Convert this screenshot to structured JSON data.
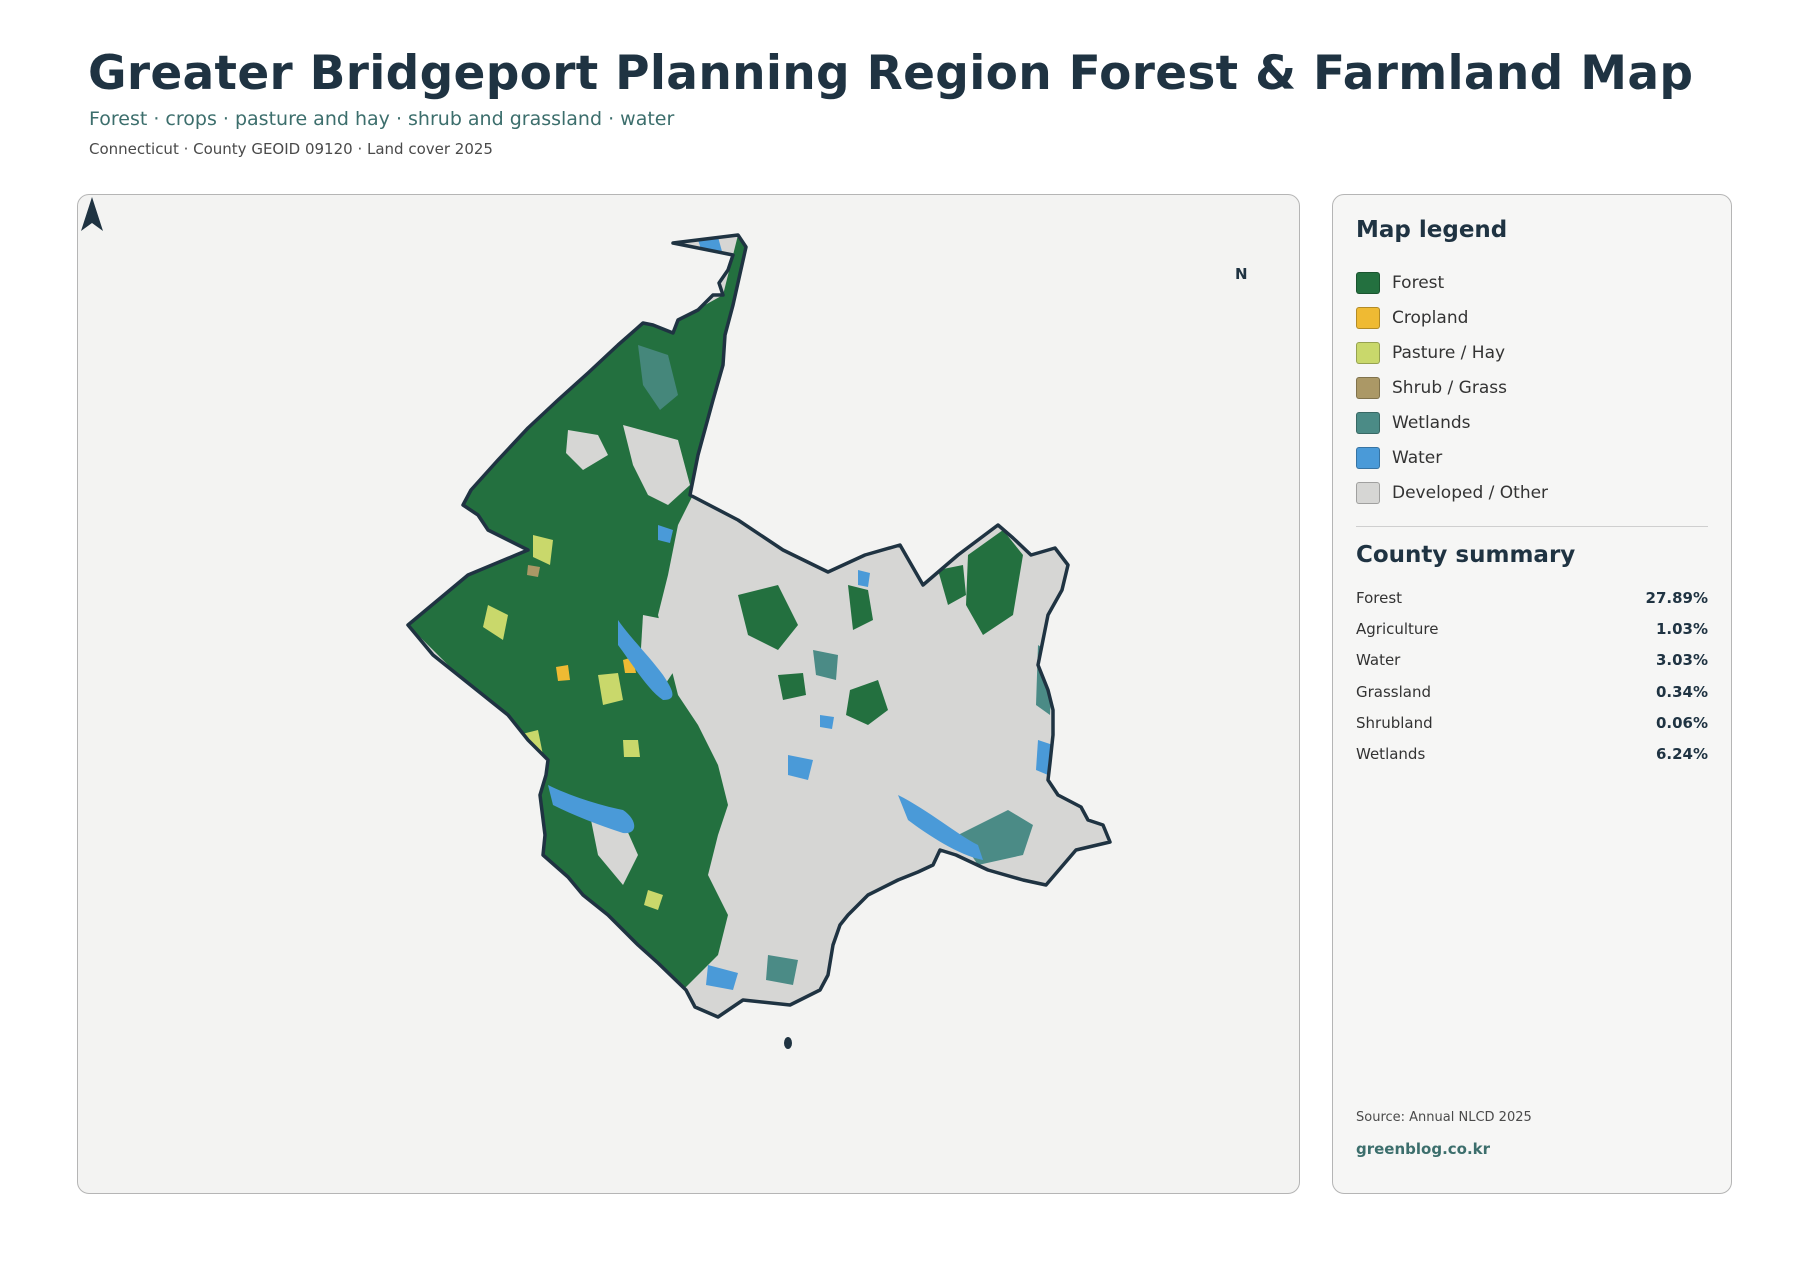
{
  "header": {
    "title": "Greater Bridgeport Planning Region Forest & Farmland Map",
    "subtitle": "Forest · crops · pasture and hay · shrub and grassland · water",
    "meta": "Connecticut · County GEOID 09120 · Land cover 2025"
  },
  "map": {
    "north_label": "N"
  },
  "legend": {
    "title": "Map legend",
    "items": [
      {
        "label": "Forest",
        "color": "#23703f"
      },
      {
        "label": "Cropland",
        "color": "#efba33"
      },
      {
        "label": "Pasture / Hay",
        "color": "#c9d86b"
      },
      {
        "label": "Shrub / Grass",
        "color": "#ab9866"
      },
      {
        "label": "Wetlands",
        "color": "#4b8b86"
      },
      {
        "label": "Water",
        "color": "#4a9ad8"
      },
      {
        "label": "Developed / Other",
        "color": "#d6d6d4"
      }
    ]
  },
  "summary": {
    "title": "County summary",
    "rows": [
      {
        "label": "Forest",
        "value": "27.89%"
      },
      {
        "label": "Agriculture",
        "value": "1.03%"
      },
      {
        "label": "Water",
        "value": "3.03%"
      },
      {
        "label": "Grassland",
        "value": "0.34%"
      },
      {
        "label": "Shrubland",
        "value": "0.06%"
      },
      {
        "label": "Wetlands",
        "value": "6.24%"
      }
    ]
  },
  "footer": {
    "source": "Source: Annual NLCD 2025",
    "site": "greenblog.co.kr"
  }
}
